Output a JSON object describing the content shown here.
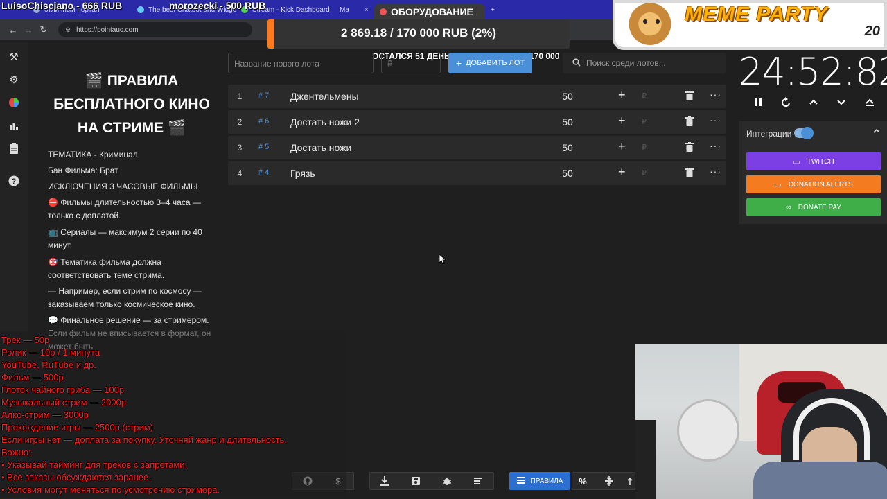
{
  "browser": {
    "tabs": [
      {
        "label": "отличный портал",
        "active": false
      },
      {
        "label": "The best Chatbot and Widget",
        "active": false
      },
      {
        "label": "Stream - Kick Dashboard",
        "active": false
      },
      {
        "label": "Ma",
        "active": false
      },
      {
        "label": "ОБОРУДОВАНИЕ",
        "active": true
      }
    ],
    "new_tab": "+",
    "close_glyph": "×",
    "url": "https://pointauc.com"
  },
  "overlay": {
    "donors": [
      {
        "text": "LuisoChisciano - 666 RUB"
      },
      {
        "text": "morozecki - 500 RUB"
      }
    ],
    "goal": {
      "text": "2 869.18 / 170 000 RUB (2%)",
      "percent": 2,
      "min": "0",
      "max": "170 000",
      "remaining": "ОСТАЛСЯ 51 ДЕНЬ"
    },
    "meme": {
      "title": "MEME PARTY",
      "number": "20"
    }
  },
  "rules": {
    "title": "🎬 ПРАВИЛА БЕСПЛАТНОГО КИНО НА СТРИМЕ 🎬",
    "lines": [
      "ТЕМАТИКА - Криминал",
      "Бан Фильма: Брат",
      "ИСКЛЮЧЕНИЯ  3 ЧАСОВЫЕ ФИЛЬМЫ",
      "⛔ Фильмы длительностью 3–4 часа — только с доплатой.",
      "📺 Сериалы — максимум 2 серии по 40 минут.",
      "🎯 Тематика фильма должна соответствовать теме стрима.",
      "— Например, если стрим по космосу — заказываем только космическое кино.",
      "💬 Финальное решение — за стримером. Если фильм не вписывается в формат, он может быть"
    ]
  },
  "lots": {
    "name_placeholder": "Название нового лота",
    "price_placeholder": "₽",
    "add_label": "ДОБАВИТЬ ЛОТ",
    "search_placeholder": "Поиск среди лотов...",
    "rows": [
      {
        "index": "1",
        "fast_id": "# 7",
        "name": "Джентельмены",
        "amount": "50"
      },
      {
        "index": "2",
        "fast_id": "# 6",
        "name": "Достать ножи 2",
        "amount": "50"
      },
      {
        "index": "3",
        "fast_id": "# 5",
        "name": "Достать ножи",
        "amount": "50"
      },
      {
        "index": "4",
        "fast_id": "# 4",
        "name": "Грязь",
        "amount": "50"
      }
    ],
    "plus": "+",
    "rub": "₽",
    "more": "···"
  },
  "timer": {
    "value": "24:52:82",
    "integrations_label": "Интеграции",
    "buttons": [
      {
        "label": "TWITCH",
        "color": "#7b3fe4"
      },
      {
        "label": "DONATION ALERTS",
        "color": "#f57b20"
      },
      {
        "label": "DONATE PAY",
        "color": "#3fae49"
      }
    ]
  },
  "toolbar": {
    "rules_label": "ПРАВИЛА",
    "percent": "%"
  },
  "price_list": [
    "Трек — 50р",
    " Ролик — 10р / 1 минута",
    "YouTube, RuTube и др.",
    " Фильм — 500р",
    " Глоток чайного гриба — 100р",
    "Музыкальный стрим — 2000р",
    " Алко-стрим — 3000р",
    " Прохождение игры — 2500р (стрим)",
    "Если игры нет — доплата за покупку. Уточняй жанр и длительность.",
    " Важно:",
    "• Указывай тайминг для треков с запретами.",
    "• Все заказы обсуждаются заранее.",
    "• Условия могут меняться по усмотрению стримера."
  ]
}
